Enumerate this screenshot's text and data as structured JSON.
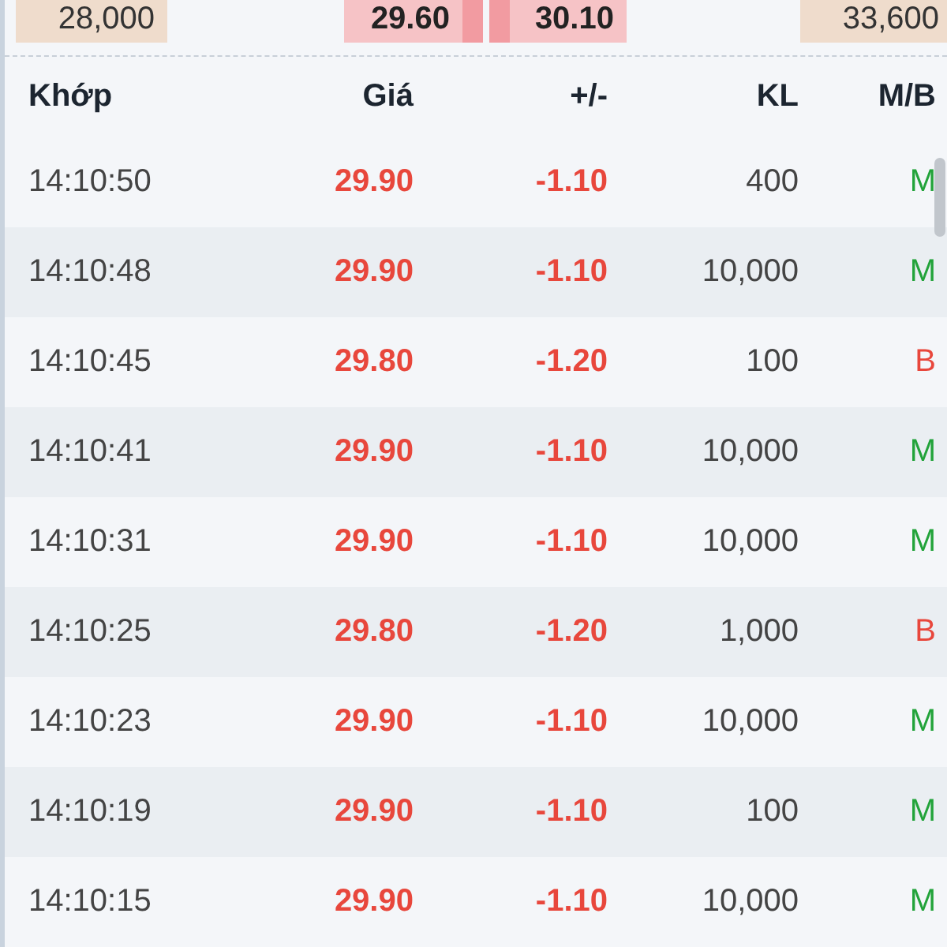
{
  "top_row": [
    {
      "text": "28,000",
      "kind": "volume",
      "marker_left": false,
      "marker_right": false
    },
    {
      "text": "29.60",
      "kind": "price",
      "marker_left": false,
      "marker_right": true
    },
    {
      "text": "30.10",
      "kind": "price",
      "marker_left": true,
      "marker_right": false
    },
    {
      "text": "33,600",
      "kind": "volume",
      "marker_left": false,
      "marker_right": false
    }
  ],
  "table": {
    "columns": [
      "Khớp",
      "Giá",
      "+/-",
      "KL",
      "M/B"
    ],
    "rows": [
      {
        "time": "14:10:50",
        "price": "29.90",
        "change": "-1.10",
        "volume": "400",
        "side": "M",
        "kind": "buy"
      },
      {
        "time": "14:10:48",
        "price": "29.90",
        "change": "-1.10",
        "volume": "10,000",
        "side": "M",
        "kind": "buy"
      },
      {
        "time": "14:10:45",
        "price": "29.80",
        "change": "-1.20",
        "volume": "100",
        "side": "B",
        "kind": "sell"
      },
      {
        "time": "14:10:41",
        "price": "29.90",
        "change": "-1.10",
        "volume": "10,000",
        "side": "M",
        "kind": "buy"
      },
      {
        "time": "14:10:31",
        "price": "29.90",
        "change": "-1.10",
        "volume": "10,000",
        "side": "M",
        "kind": "buy"
      },
      {
        "time": "14:10:25",
        "price": "29.80",
        "change": "-1.20",
        "volume": "1,000",
        "side": "B",
        "kind": "sell"
      },
      {
        "time": "14:10:23",
        "price": "29.90",
        "change": "-1.10",
        "volume": "10,000",
        "side": "M",
        "kind": "buy"
      },
      {
        "time": "14:10:19",
        "price": "29.90",
        "change": "-1.10",
        "volume": "100",
        "side": "M",
        "kind": "buy"
      },
      {
        "time": "14:10:15",
        "price": "29.90",
        "change": "-1.10",
        "volume": "10,000",
        "side": "M",
        "kind": "buy"
      }
    ]
  }
}
